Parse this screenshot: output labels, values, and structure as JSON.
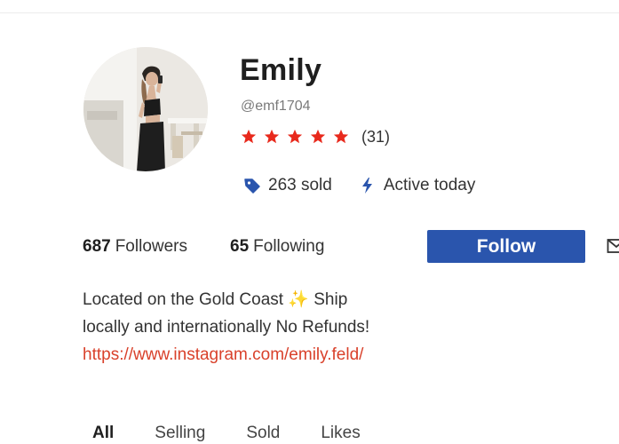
{
  "profile": {
    "display_name": "Emily",
    "username": "@emf1704",
    "rating_stars": 5,
    "review_count": "(31)",
    "sold": "263 sold",
    "activity": "Active today",
    "avatar_icon": "profile-photo"
  },
  "stats": {
    "followers_count": "687",
    "followers_label": "Followers",
    "following_count": "65",
    "following_label": "Following"
  },
  "actions": {
    "follow_label": "Follow",
    "message_icon": "envelope-icon"
  },
  "bio": {
    "line1": "Located on the Gold Coast ✨ Ship",
    "line2": "locally and internationally No Refunds!",
    "link": "https://www.instagram.com/emily.feld/"
  },
  "tabs": [
    {
      "label": "All",
      "active": true
    },
    {
      "label": "Selling",
      "active": false
    },
    {
      "label": "Sold",
      "active": false
    },
    {
      "label": "Likes",
      "active": false
    }
  ],
  "colors": {
    "accent": "#2a55ad",
    "star": "#e8291c",
    "link": "#d9412b",
    "tag_icon": "#2a55ad"
  }
}
